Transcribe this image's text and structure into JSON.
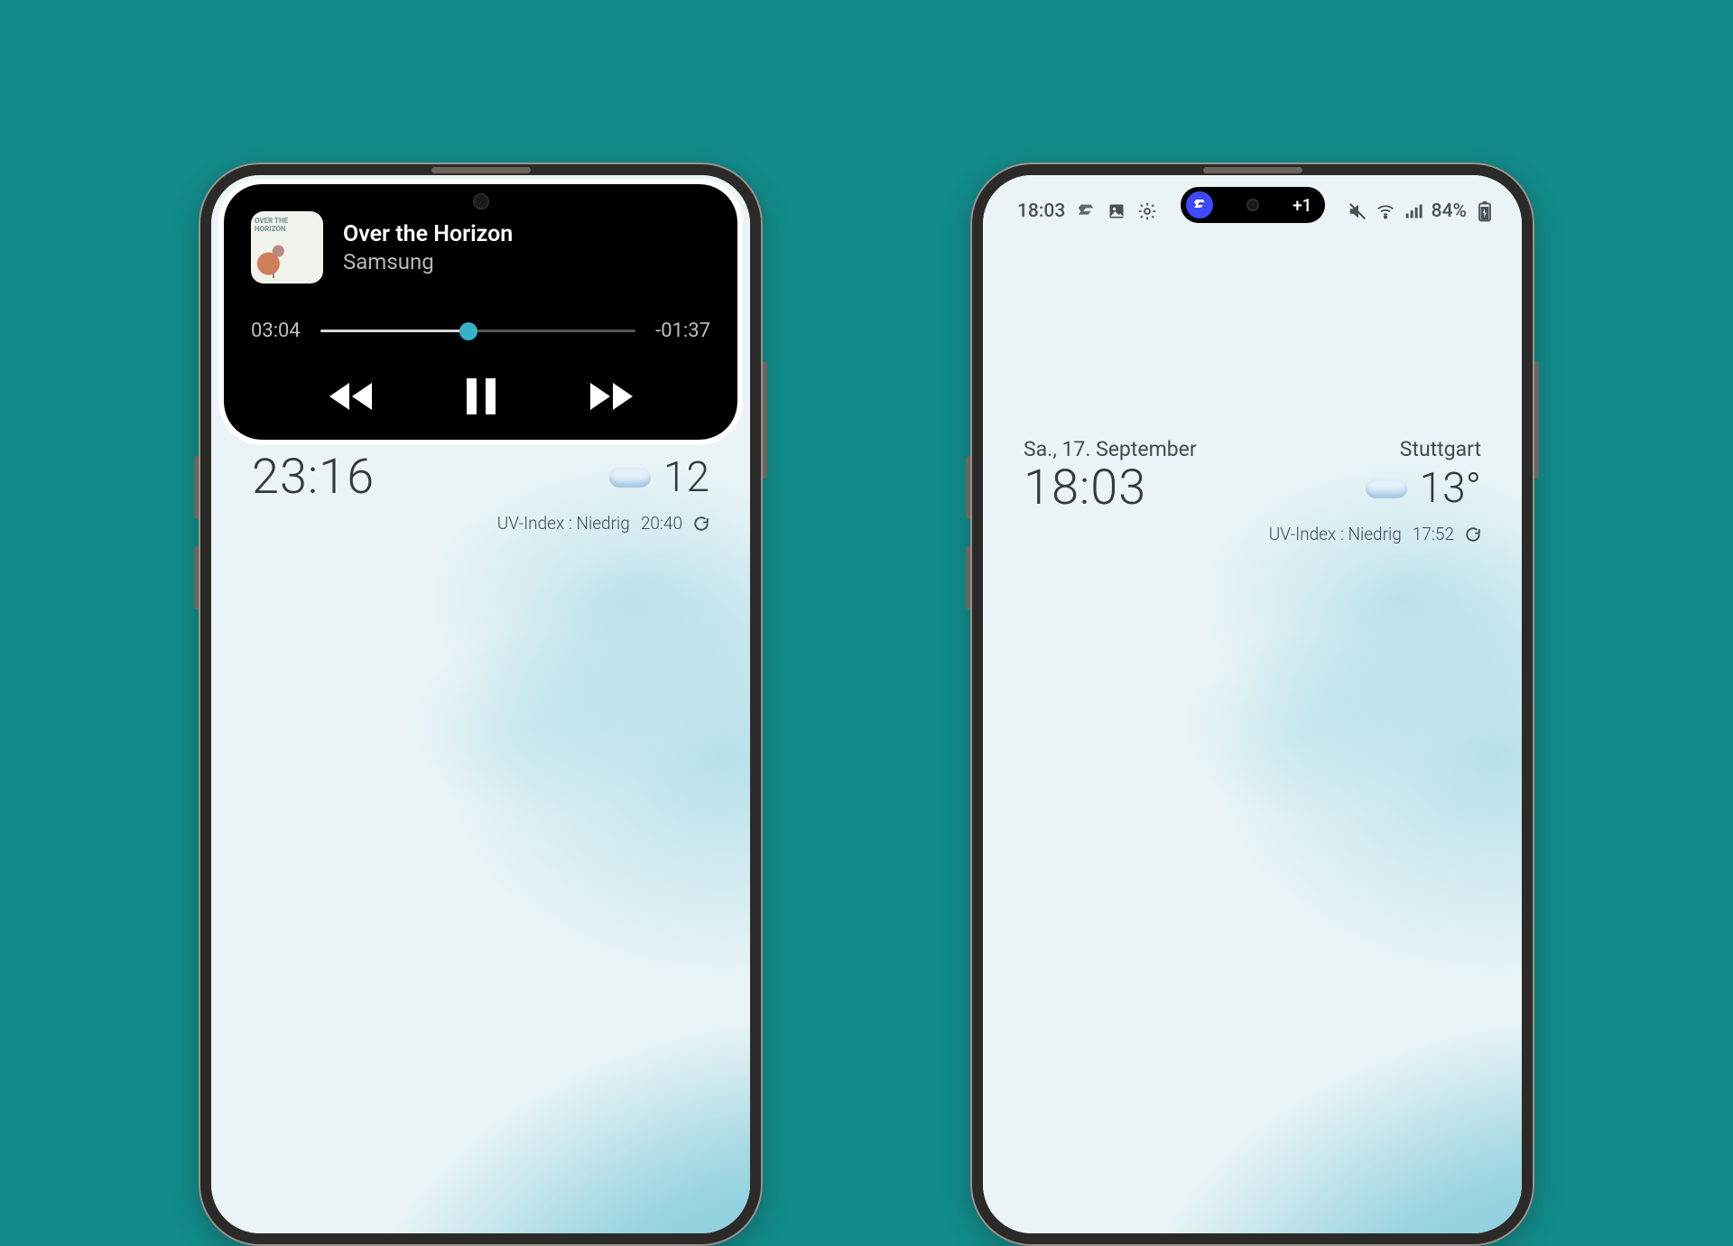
{
  "left": {
    "player": {
      "album_label": "OVER THE HORIZON",
      "title": "Over the Horizon",
      "artist": "Samsung",
      "elapsed": "03:04",
      "remaining": "-01:37"
    },
    "clock": "23:16",
    "temperature": "12",
    "uv": "UV-Index : Niedrig",
    "updated": "20:40"
  },
  "right": {
    "status_time": "18:03",
    "battery": "84%",
    "pill_extra": "+1",
    "date": "Sa., 17. September",
    "city": "Stuttgart",
    "clock": "18:03",
    "temperature": "13°",
    "uv": "UV-Index : Niedrig",
    "updated": "17:52"
  }
}
